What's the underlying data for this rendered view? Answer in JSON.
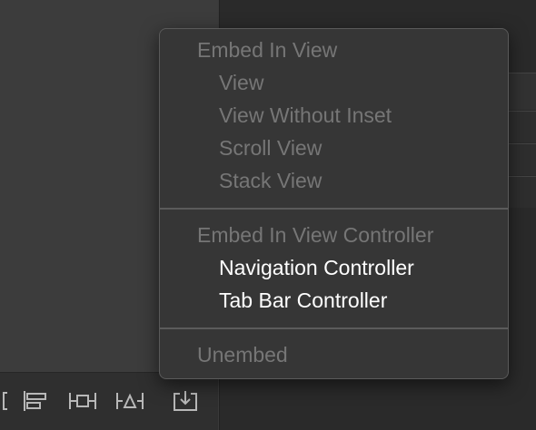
{
  "menu": {
    "embed_in_view": {
      "header": "Embed In View",
      "items": [
        {
          "label": "View",
          "enabled": false
        },
        {
          "label": "View Without Inset",
          "enabled": false
        },
        {
          "label": "Scroll View",
          "enabled": false
        },
        {
          "label": "Stack View",
          "enabled": false
        }
      ]
    },
    "embed_in_view_controller": {
      "header": "Embed In View Controller",
      "items": [
        {
          "label": "Navigation Controller",
          "enabled": true
        },
        {
          "label": "Tab Bar Controller",
          "enabled": true
        }
      ]
    },
    "unembed": {
      "label": "Unembed",
      "enabled": false
    }
  },
  "toolbar": {
    "icons": [
      "align-icon",
      "add-new-constraints-icon",
      "resolve-auto-layout-icon",
      "embed-in-icon"
    ]
  },
  "colors": {
    "menu_background": "#363636",
    "disabled_text": "#767676",
    "enabled_text": "#ffffff",
    "separator": "#5b5b5b"
  }
}
